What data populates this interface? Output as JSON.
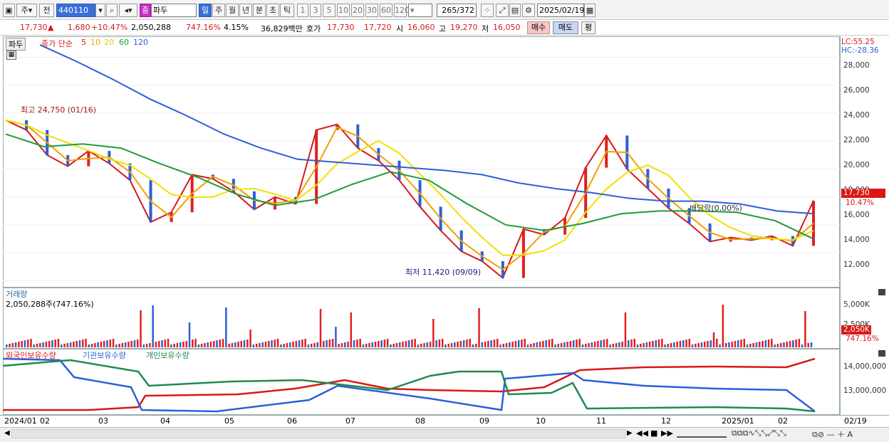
{
  "toolbar": {
    "type_btn": "주",
    "prev_btn": "전",
    "code": "440110",
    "name": "파두",
    "name_badge": "종",
    "period_buttons": [
      "일",
      "주",
      "월",
      "년",
      "분",
      "초",
      "틱"
    ],
    "interval_buttons": [
      "1",
      "3",
      "5",
      "10",
      "20",
      "30",
      "60",
      "120"
    ],
    "count": "265",
    "total": "/372",
    "date": "2025/02/19"
  },
  "quote": {
    "price": "17,730",
    "arrow": "▲",
    "change": "1,680",
    "change_pct": "+10.47%",
    "volume": "2,050,288",
    "vol_ratio": "747.16%",
    "turnover": "4.15%",
    "amount": "36,829백만",
    "ask_label": "호가",
    "ask": "17,730",
    "bid": "17,720",
    "open_label": "시",
    "open": "16,060",
    "high_label": "고",
    "high": "19,270",
    "low_label": "저",
    "low": "16,050",
    "buy_btn": "매수",
    "sell_btn": "매도",
    "eval_btn": "평"
  },
  "price_pane": {
    "name_tag": "파두",
    "ma_title": "종가 단순",
    "ma_periods": [
      "5",
      "10",
      "20",
      "60",
      "120"
    ],
    "ma_colors": [
      "#d81818",
      "#f0a000",
      "#e8e000",
      "#1f9a3a",
      "#2c5fd8"
    ],
    "lc": "LC:55.25",
    "hc": "HC:-28.36",
    "y_ticks": [
      "28,000",
      "26,000",
      "24,000",
      "22,000",
      "20,000",
      "18,000",
      "16,000",
      "14,000",
      "12,000"
    ],
    "high_note": "최고 24,750 (01/16)",
    "low_note": "최저 11,420 (09/09)",
    "dividend_note": "배당락(0.00%)",
    "last_price_tag": "17,730",
    "last_pct_tag": "10.47%"
  },
  "volume_pane": {
    "title": "거래량",
    "value": "2,050,288주(747.16%)",
    "y_ticks": [
      "5,000K",
      "2,500K"
    ],
    "last_tag": "2,050K",
    "last_pct": "747.16%"
  },
  "holding_pane": {
    "legend": [
      "외국인보유수량",
      "기관보유수량",
      "개인보유수량"
    ],
    "colors": [
      "#d81818",
      "#2c5fd8",
      "#1f8a50"
    ],
    "y_ticks": [
      "14,000,000",
      "13,000,000"
    ]
  },
  "x_axis": {
    "labels": [
      "2024/01",
      "02",
      "03",
      "04",
      "05",
      "06",
      "07",
      "08",
      "09",
      "10",
      "11",
      "12",
      "2025/01",
      "02",
      "02/19"
    ]
  },
  "chart_data": {
    "type": "line",
    "title": "",
    "series": [
      {
        "name": "close",
        "values": [
          23500,
          22800,
          21000,
          20200,
          21300,
          20400,
          19200,
          16200,
          16900,
          19600,
          19300,
          18400,
          17100,
          18000,
          17500,
          22800,
          23200,
          21500,
          20600,
          19200,
          17300,
          15600,
          14100,
          13400,
          12200,
          15700,
          15300,
          16500,
          20100,
          22400,
          20000,
          18600,
          17200,
          16100,
          14800,
          15100,
          14900,
          15200,
          14500,
          17730
        ]
      },
      {
        "name": "120",
        "values": [
          28900,
          27700,
          26400,
          25000,
          23800,
          22500,
          21500,
          20700,
          20500,
          20300,
          20100,
          19900,
          19600,
          19000,
          18600,
          18300,
          17900,
          17700,
          17700,
          17500,
          17000,
          16800
        ]
      },
      {
        "name": "60",
        "values": [
          22500,
          21600,
          21800,
          21500,
          20400,
          19400,
          18200,
          17400,
          17800,
          18900,
          19800,
          19200,
          17500,
          16000,
          15600,
          16100,
          16800,
          17000,
          17000,
          16900,
          16300,
          15000
        ]
      }
    ],
    "ylim": [
      11000,
      29000
    ]
  }
}
